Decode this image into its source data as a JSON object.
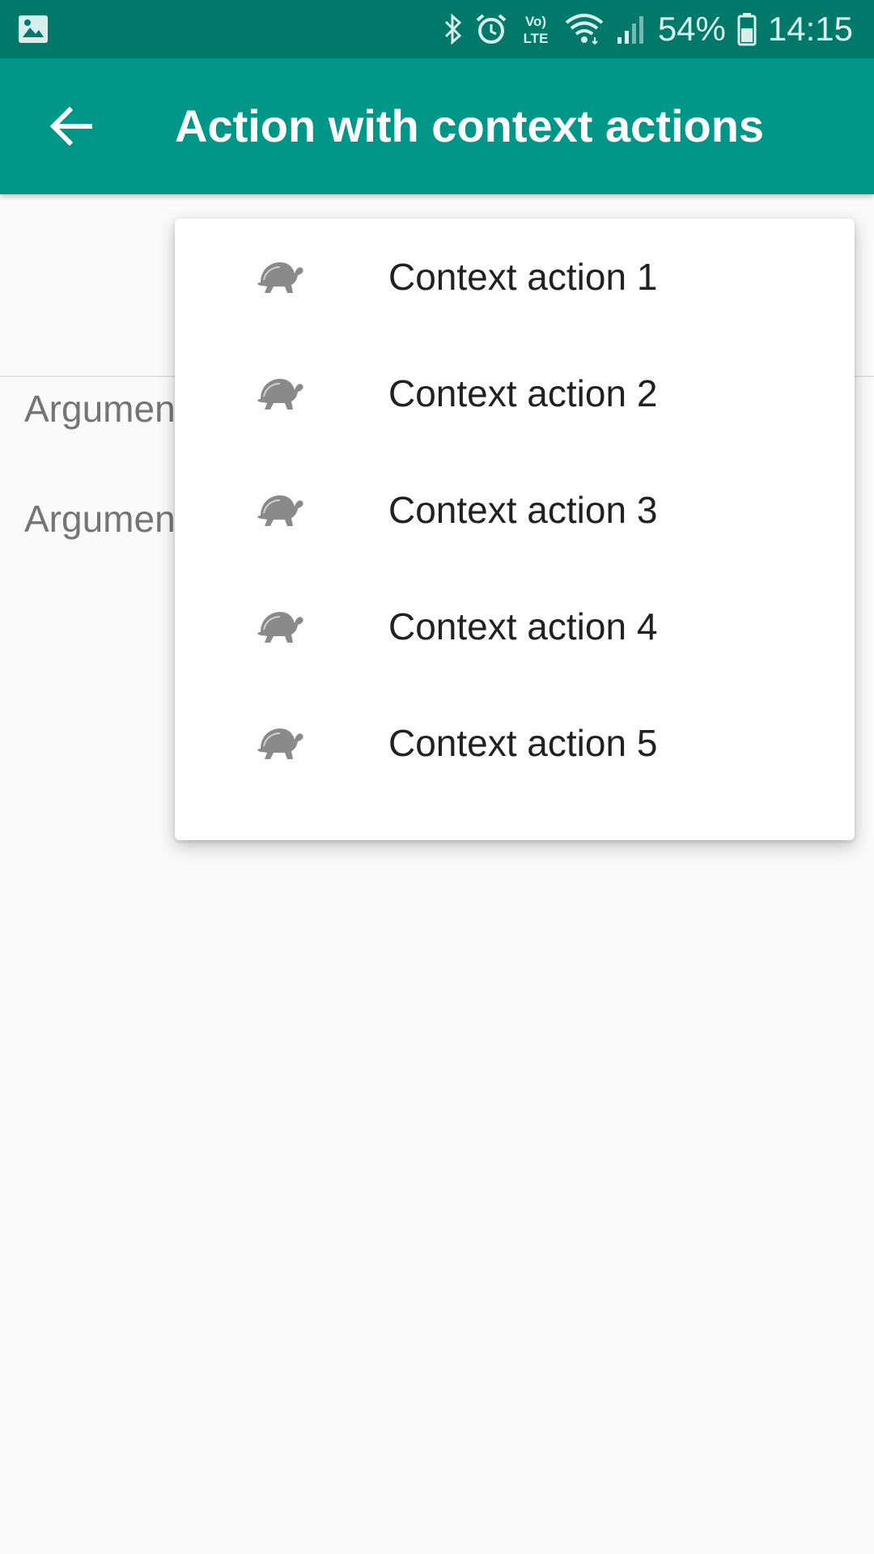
{
  "status_bar": {
    "battery": "54%",
    "time": "14:15",
    "icons": [
      "image-icon",
      "bluetooth-icon",
      "alarm-icon",
      "volte-icon",
      "wifi-icon",
      "signal-icon",
      "battery-icon"
    ],
    "volte_top": "Vo)",
    "volte_bottom": "LTE"
  },
  "app_bar": {
    "title": "Action with context actions",
    "back_icon": "arrow-back-icon"
  },
  "content": {
    "rows": [
      {
        "label": "Argumen"
      },
      {
        "label": "Argumen"
      }
    ]
  },
  "popup_menu": {
    "items": [
      {
        "label": "Context action 1",
        "icon": "turtle-icon"
      },
      {
        "label": "Context action 2",
        "icon": "turtle-icon"
      },
      {
        "label": "Context action 3",
        "icon": "turtle-icon"
      },
      {
        "label": "Context action 4",
        "icon": "turtle-icon"
      },
      {
        "label": "Context action 5",
        "icon": "turtle-icon"
      }
    ]
  },
  "colors": {
    "status_bar": "#00796b",
    "app_bar": "#009688",
    "background": "#fafafa",
    "menu_text": "#212121",
    "secondary_text": "#757575",
    "icon_gray": "#8a8a8a"
  }
}
